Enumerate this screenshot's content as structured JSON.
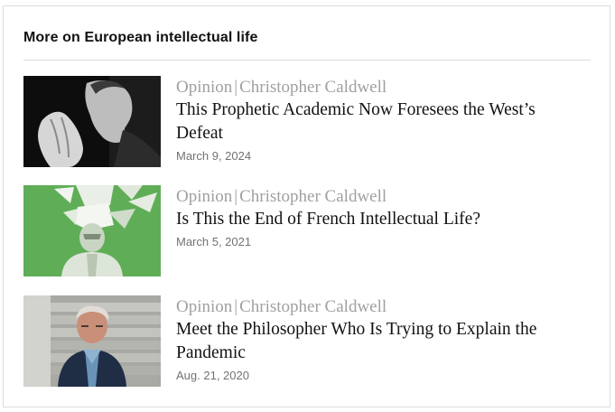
{
  "section": {
    "heading": "More on European intellectual life"
  },
  "articles": [
    {
      "section_label": "Opinion",
      "separator": "|",
      "author": "Christopher Caldwell",
      "headline": "This Prophetic Academic Now Foresees the West’s Defeat",
      "date": "March 9, 2024",
      "image_icon": "portrait-bw-hands-clasped"
    },
    {
      "section_label": "Opinion",
      "separator": "|",
      "author": "Christopher Caldwell",
      "headline": "Is This the End of French Intellectual Life?",
      "date": "March 5, 2021",
      "image_icon": "illustration-green-paper-head"
    },
    {
      "section_label": "Opinion",
      "separator": "|",
      "author": "Christopher Caldwell",
      "headline": "Meet the Philosopher Who Is Trying to Explain the Pandemic",
      "date": "Aug. 21, 2020",
      "image_icon": "portrait-man-on-stairs"
    }
  ]
}
